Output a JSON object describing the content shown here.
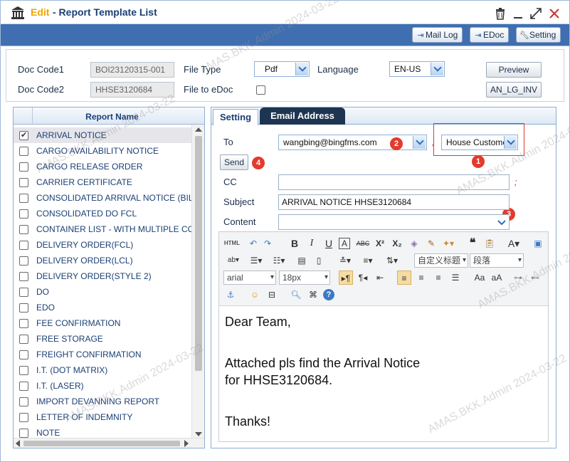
{
  "window": {
    "title_edit": "Edit",
    "title_rest": "- Report Template List",
    "controls": [
      "trash-icon",
      "minimize-icon",
      "maximize-icon",
      "close-icon"
    ]
  },
  "toolbar": {
    "mail_log": "Mail Log",
    "edoc": "EDoc",
    "setting": "Setting"
  },
  "header": {
    "doc_code1_label": "Doc Code1",
    "doc_code1_value": "BOI23120315-001",
    "doc_code2_label": "Doc Code2",
    "doc_code2_value": "HHSE3120684",
    "file_type_label": "File Type",
    "file_type_value": "Pdf",
    "file_to_edoc_label": "File to eDoc",
    "language_label": "Language",
    "language_value": "EN-US",
    "preview_button": "Preview",
    "template_button": "AN_LG_INV"
  },
  "list": {
    "column_header": "Report Name",
    "items": [
      {
        "name": "ARRIVAL NOTICE",
        "checked": true
      },
      {
        "name": "CARGO AVAILABILITY NOTICE",
        "checked": false
      },
      {
        "name": "CARGO RELEASE ORDER",
        "checked": false
      },
      {
        "name": "CARRIER CERTIFICATE",
        "checked": false
      },
      {
        "name": "CONSOLIDATED ARRIVAL NOTICE (BIL",
        "checked": false
      },
      {
        "name": "CONSOLIDATED DO FCL",
        "checked": false
      },
      {
        "name": "CONTAINER LIST - WITH MULTIPLE CO",
        "checked": false
      },
      {
        "name": "DELIVERY ORDER(FCL)",
        "checked": false
      },
      {
        "name": "DELIVERY ORDER(LCL)",
        "checked": false
      },
      {
        "name": "DELIVERY ORDER(STYLE 2)",
        "checked": false
      },
      {
        "name": "DO",
        "checked": false
      },
      {
        "name": "EDO",
        "checked": false
      },
      {
        "name": "FEE CONFIRMATION",
        "checked": false
      },
      {
        "name": "FREE STORAGE",
        "checked": false
      },
      {
        "name": "FREIGHT CONFIRMATION",
        "checked": false
      },
      {
        "name": "I.T. (DOT MATRIX)",
        "checked": false
      },
      {
        "name": "I.T. (LASER)",
        "checked": false
      },
      {
        "name": "IMPORT DEVANNING REPORT",
        "checked": false
      },
      {
        "name": "LETTER OF INDEMNITY",
        "checked": false
      },
      {
        "name": "NOTE",
        "checked": false
      }
    ]
  },
  "tabs": {
    "setting": "Setting",
    "email_address": "Email Address"
  },
  "email": {
    "to_label": "To",
    "to_value": "wangbing@bingfms.com",
    "separator": ";",
    "party_value": "House Custome",
    "send_button": "Send",
    "cc_label": "CC",
    "cc_value": "",
    "subject_label": "Subject",
    "subject_value": "ARRIVAL NOTICE HHSE3120684",
    "content_label": "Content",
    "content_value": ""
  },
  "badges": [
    "1",
    "2",
    "3",
    "4"
  ],
  "editor": {
    "html_btn": "HTML",
    "style_select": "自定义标题",
    "paragraph_select": "段落",
    "font_select": "arial",
    "size_select": "18px",
    "body": {
      "line1": "Dear Team,",
      "line2": "Attached pls find the Arrival Notice",
      "line3": "for HHSE3120684.",
      "line4": "Thanks!"
    }
  },
  "watermark": "AMAS.BKK.Admin 2024-03-22",
  "colors": {
    "toolbar_band": "#3f6fb0",
    "title_edit": "#f0a500",
    "badge_red": "#e23b2e",
    "tab_dark": "#1e3552"
  }
}
